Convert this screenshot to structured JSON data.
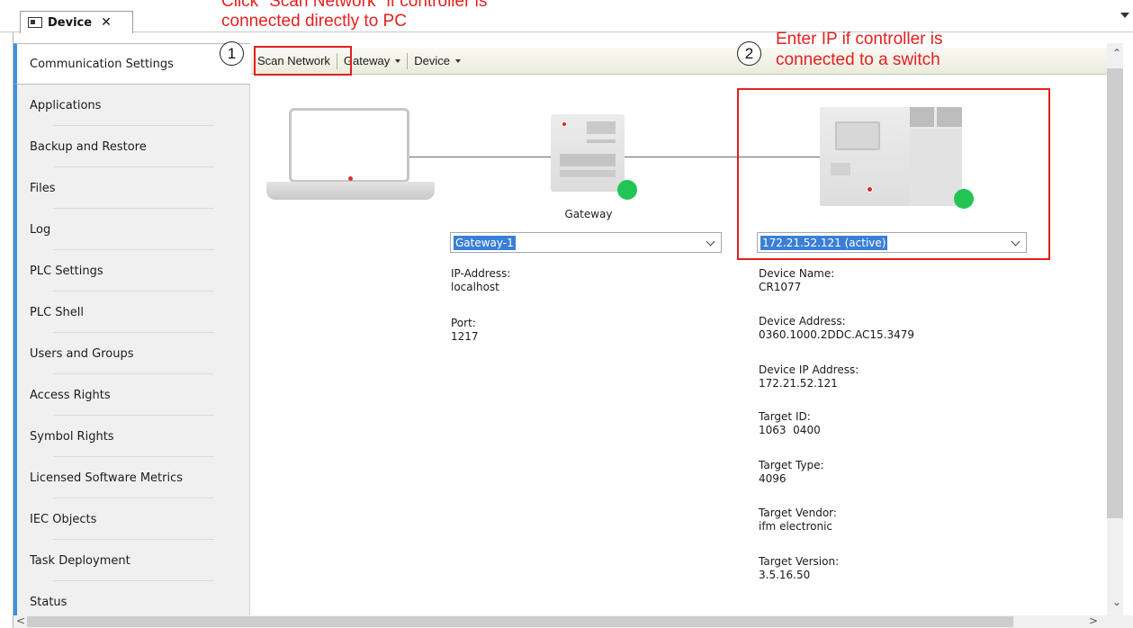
{
  "tab": {
    "label": "Device",
    "close": "✕"
  },
  "annotations": {
    "step1_number": "1",
    "step1_text_line1": "Click \"Scan Network\" if controller is",
    "step1_text_line2": "connected directly to PC",
    "step2_number": "2",
    "step2_text_line1": "Enter IP if controller is",
    "step2_text_line2": "connected to a switch",
    "color": "#e42020"
  },
  "sidebar": {
    "active_index": 0,
    "accent": "#3d8fe0",
    "items": [
      "Communication Settings",
      "Applications",
      "Backup and Restore",
      "Files",
      "Log",
      "PLC Settings",
      "PLC Shell",
      "Users and Groups",
      "Access Rights",
      "Symbol Rights",
      "Licensed Software Metrics",
      "IEC Objects",
      "Task Deployment",
      "Status"
    ]
  },
  "toolbar": {
    "scan_network": "Scan Network",
    "gateway": "Gateway",
    "device": "Device"
  },
  "gateway": {
    "caption": "Gateway",
    "selected": "Gateway-1",
    "ip_label": "IP-Address:",
    "ip_value": "localhost",
    "port_label": "Port:",
    "port_value": "1217",
    "status_color": "#22c454"
  },
  "device": {
    "selected": "172.21.52.121 (active)",
    "status_color": "#22c454",
    "properties": [
      {
        "label": "Device Name:",
        "value": "CR1077"
      },
      {
        "label": "Device Address:",
        "value": "0360.1000.2DDC.AC15.3479"
      },
      {
        "label": "Device IP Address:",
        "value": "172.21.52.121"
      },
      {
        "label": "Target ID:",
        "value": "1063  0400"
      },
      {
        "label": "Target Type:",
        "value": "4096"
      },
      {
        "label": "Target Vendor:",
        "value": "ifm electronic"
      },
      {
        "label": "Target Version:",
        "value": "3.5.16.50"
      }
    ]
  }
}
